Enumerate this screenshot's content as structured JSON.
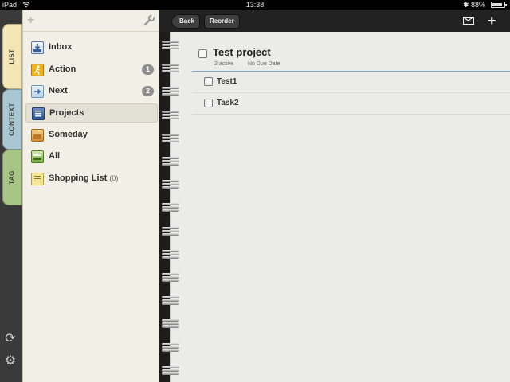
{
  "status_bar": {
    "device": "iPad",
    "time": "13:38",
    "battery": "88%",
    "battery_level": 0.88
  },
  "side_tabs": [
    "LIST",
    "CONTEXT",
    "TAG"
  ],
  "sidebar": {
    "items": [
      {
        "label": "Inbox",
        "icon": "inbox-icon",
        "badge": "",
        "count": ""
      },
      {
        "label": "Action",
        "icon": "action-runner-icon",
        "badge": "1",
        "count": ""
      },
      {
        "label": "Next",
        "icon": "next-icon",
        "badge": "2",
        "count": ""
      },
      {
        "label": "Projects",
        "icon": "projects-icon",
        "badge": "",
        "count": ""
      },
      {
        "label": "Someday",
        "icon": "someday-icon",
        "badge": "",
        "count": ""
      },
      {
        "label": "All",
        "icon": "all-icon",
        "badge": "",
        "count": ""
      },
      {
        "label": "Shopping List",
        "icon": "shopping-list-icon",
        "badge": "",
        "count": "(0)"
      }
    ],
    "selected": "Projects"
  },
  "header": {
    "back_label": "Back",
    "reorder_label": "Reorder"
  },
  "project": {
    "title": "Test project",
    "active": "2 active",
    "due": "No Due Date",
    "tasks": [
      "Test1",
      "Task2"
    ]
  },
  "colors": {
    "list_tab": "#f3e6b4",
    "context_tab": "#a9c6d3",
    "tag_tab": "#a7c585",
    "accent_line": "#7aa6c9"
  }
}
